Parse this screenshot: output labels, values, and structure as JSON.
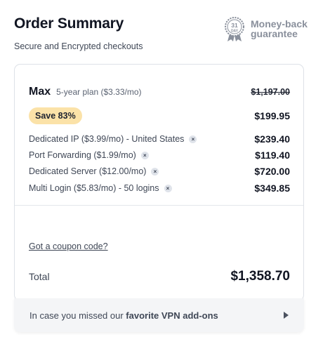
{
  "header": {
    "title": "Order Summary",
    "subtitle": "Secure and Encrypted checkouts",
    "seal_top": "31",
    "seal_bottom": "DAY",
    "guarantee_line1": "Money-back",
    "guarantee_line2": "guarantee"
  },
  "plan": {
    "name": "Max",
    "description": "5-year plan ($3.33/mo)",
    "original_price": "$1,197.00",
    "save_label": "Save 83%",
    "price": "$199.95"
  },
  "addons": [
    {
      "label": "Dedicated IP ($3.99/mo) - United States",
      "price": "$239.40"
    },
    {
      "label": "Port Forwarding ($1.99/mo)",
      "price": "$119.40"
    },
    {
      "label": "Dedicated Server ($12.00/mo)",
      "price": "$720.00"
    },
    {
      "label": "Multi Login ($5.83/mo) - 50 logins",
      "price": "$349.85"
    }
  ],
  "remove_glyph": "×",
  "coupon_link": "Got a coupon code?",
  "total": {
    "label": "Total",
    "value": "$1,358.70"
  },
  "footer": {
    "prefix": "In case you missed our ",
    "bold": "favorite VPN add-ons"
  }
}
